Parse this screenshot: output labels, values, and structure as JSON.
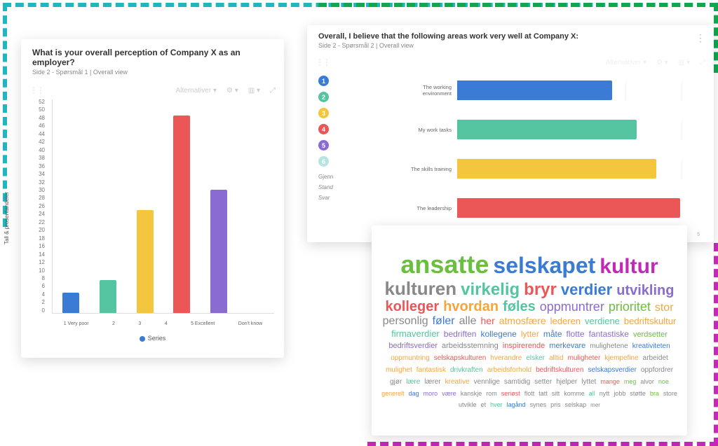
{
  "chart_data": [
    {
      "id": "bar",
      "type": "bar",
      "title": "What is your overall perception of Company X as an employer?",
      "subtitle": "Side 2 - Spørsmål 1 | Overall view",
      "ylabel": "Tall & prosentandeler",
      "ylim": [
        0,
        52
      ],
      "yticks": [
        52,
        50,
        48,
        46,
        44,
        42,
        40,
        38,
        36,
        34,
        32,
        30,
        28,
        26,
        24,
        22,
        20,
        18,
        16,
        14,
        12,
        10,
        8,
        6,
        4,
        2,
        0
      ],
      "categories": [
        "1 Very poor",
        "2",
        "3",
        "4",
        "5 Excellent",
        "Don't know"
      ],
      "values": [
        5,
        8,
        25,
        48,
        30,
        0
      ],
      "colors": [
        "#3a7bd5",
        "#55c5a1",
        "#f4c63d",
        "#eb5757",
        "#8a6bd1",
        "#c7c7c7"
      ],
      "legend_label": "Series",
      "toolbar": {
        "alt_label": "Alternativer"
      }
    },
    {
      "id": "hbar",
      "type": "bar",
      "orientation": "horizontal",
      "title": "Overall, I believe that the following areas work very well at Company X:",
      "subtitle": "Side 2 - Spørsmål 2 | Overall view",
      "xlim": [
        0,
        5
      ],
      "categories": [
        "The working environment",
        "My work tasks",
        "The skills training",
        "The leadership"
      ],
      "values": [
        3.2,
        3.7,
        4.1,
        4.6
      ],
      "colors": [
        "#3a7bd5",
        "#55c5a1",
        "#f4c63d",
        "#eb5757"
      ],
      "legend_badges": [
        {
          "n": "1",
          "c": "#3a7bd5"
        },
        {
          "n": "2",
          "c": "#55c5a1"
        },
        {
          "n": "3",
          "c": "#f4c63d"
        },
        {
          "n": "4",
          "c": "#eb5757"
        },
        {
          "n": "5",
          "c": "#8a6bd1"
        },
        {
          "n": "6",
          "c": "#b7e3e0"
        }
      ],
      "side_stats": [
        "Gjenn",
        "Stand",
        "Svar"
      ]
    }
  ],
  "wordcloud": {
    "words": [
      {
        "t": "ansatte",
        "s": 36,
        "c": "#6bbf3f"
      },
      {
        "t": "selskapet",
        "s": 32,
        "c": "#3a7bd5"
      },
      {
        "t": "kultur",
        "s": 30,
        "c": "#c229b8"
      },
      {
        "t": "kulturen",
        "s": 26,
        "c": "#888"
      },
      {
        "t": "virkelig",
        "s": 24,
        "c": "#55c5a1"
      },
      {
        "t": "bryr",
        "s": 24,
        "c": "#eb5757"
      },
      {
        "t": "verdier",
        "s": 22,
        "c": "#3a7bd5"
      },
      {
        "t": "utvikling",
        "s": 20,
        "c": "#8a6bd1"
      },
      {
        "t": "kolleger",
        "s": 20,
        "c": "#eb5757"
      },
      {
        "t": "hvordan",
        "s": 20,
        "c": "#f4a63d"
      },
      {
        "t": "føles",
        "s": 20,
        "c": "#55c5a1"
      },
      {
        "t": "oppmuntrer",
        "s": 18,
        "c": "#8a6bd1"
      },
      {
        "t": "prioritet",
        "s": 18,
        "c": "#6bbf3f"
      },
      {
        "t": "stor",
        "s": 16,
        "c": "#f4a63d"
      },
      {
        "t": "personlig",
        "s": 16,
        "c": "#888"
      },
      {
        "t": "føler",
        "s": 16,
        "c": "#3a7bd5"
      },
      {
        "t": "alle",
        "s": 16,
        "c": "#888"
      },
      {
        "t": "her",
        "s": 14,
        "c": "#eb5757"
      },
      {
        "t": "atmosfære",
        "s": 14,
        "c": "#f4a63d"
      },
      {
        "t": "lederen",
        "s": 13,
        "c": "#f4a63d"
      },
      {
        "t": "verdiene",
        "s": 13,
        "c": "#55c5a1"
      },
      {
        "t": "bedriftskultur",
        "s": 13,
        "c": "#f4a63d"
      },
      {
        "t": "firmaverdier",
        "s": 13,
        "c": "#55c5a1"
      },
      {
        "t": "bedriften",
        "s": 12,
        "c": "#8a6bd1"
      },
      {
        "t": "kollegene",
        "s": 12,
        "c": "#3a7bd5"
      },
      {
        "t": "lytter",
        "s": 12,
        "c": "#f4a63d"
      },
      {
        "t": "måte",
        "s": 12,
        "c": "#3a7bd5"
      },
      {
        "t": "flotte",
        "s": 12,
        "c": "#8a6bd1"
      },
      {
        "t": "fantastiske",
        "s": 12,
        "c": "#8a6bd1"
      },
      {
        "t": "verdsetter",
        "s": 11,
        "c": "#6bbf3f"
      },
      {
        "t": "bedriftsverdier",
        "s": 11,
        "c": "#8a6bd1"
      },
      {
        "t": "arbeidsstemning",
        "s": 11,
        "c": "#888"
      },
      {
        "t": "inspirerende",
        "s": 11,
        "c": "#eb5757"
      },
      {
        "t": "merkevare",
        "s": 11,
        "c": "#3a7bd5"
      },
      {
        "t": "mulighetene",
        "s": 10,
        "c": "#888"
      },
      {
        "t": "kreativiteten",
        "s": 10,
        "c": "#3a7bd5"
      },
      {
        "t": "oppmuntring",
        "s": 10,
        "c": "#f4a63d"
      },
      {
        "t": "selskapskulturen",
        "s": 10,
        "c": "#eb5757"
      },
      {
        "t": "hverandre",
        "s": 10,
        "c": "#f4a63d"
      },
      {
        "t": "elsker",
        "s": 10,
        "c": "#55c5a1"
      },
      {
        "t": "alltid",
        "s": 10,
        "c": "#f4a63d"
      },
      {
        "t": "muligheter",
        "s": 10,
        "c": "#eb5757"
      },
      {
        "t": "kjempefine",
        "s": 10,
        "c": "#f4a63d"
      },
      {
        "t": "arbeidet",
        "s": 10,
        "c": "#888"
      },
      {
        "t": "mulighet",
        "s": 10,
        "c": "#f4a63d"
      },
      {
        "t": "fantastisk",
        "s": 10,
        "c": "#f4a63d"
      },
      {
        "t": "drivkraften",
        "s": 10,
        "c": "#55c5a1"
      },
      {
        "t": "arbeidsforhold",
        "s": 10,
        "c": "#f4a63d"
      },
      {
        "t": "bedriftskulturen",
        "s": 10,
        "c": "#eb5757"
      },
      {
        "t": "selskapsverdier",
        "s": 10,
        "c": "#3a7bd5"
      },
      {
        "t": "oppfordrer",
        "s": 10,
        "c": "#888"
      },
      {
        "t": "gjør",
        "s": 10,
        "c": "#888"
      },
      {
        "t": "lære",
        "s": 10,
        "c": "#55c5a1"
      },
      {
        "t": "lærer",
        "s": 10,
        "c": "#888"
      },
      {
        "t": "kreative",
        "s": 10,
        "c": "#f4a63d"
      },
      {
        "t": "vennlige",
        "s": 10,
        "c": "#888"
      },
      {
        "t": "samtidig",
        "s": 10,
        "c": "#888"
      },
      {
        "t": "setter",
        "s": 10,
        "c": "#888"
      },
      {
        "t": "hjelper",
        "s": 10,
        "c": "#888"
      },
      {
        "t": "lyttet",
        "s": 10,
        "c": "#888"
      },
      {
        "t": "mange",
        "s": 9,
        "c": "#eb5757"
      },
      {
        "t": "meg",
        "s": 9,
        "c": "#6bbf3f"
      },
      {
        "t": "alvor",
        "s": 9,
        "c": "#888"
      },
      {
        "t": "noe",
        "s": 9,
        "c": "#6bbf3f"
      },
      {
        "t": "generelt",
        "s": 9,
        "c": "#f4a63d"
      },
      {
        "t": "dag",
        "s": 9,
        "c": "#3a7bd5"
      },
      {
        "t": "moro",
        "s": 9,
        "c": "#8a6bd1"
      },
      {
        "t": "være",
        "s": 9,
        "c": "#8a6bd1"
      },
      {
        "t": "kanskje",
        "s": 9,
        "c": "#888"
      },
      {
        "t": "rom",
        "s": 9,
        "c": "#888"
      },
      {
        "t": "seriøst",
        "s": 9,
        "c": "#eb5757"
      },
      {
        "t": "flott",
        "s": 9,
        "c": "#888"
      },
      {
        "t": "tatt",
        "s": 9,
        "c": "#888"
      },
      {
        "t": "sitt",
        "s": 9,
        "c": "#888"
      },
      {
        "t": "komme",
        "s": 9,
        "c": "#888"
      },
      {
        "t": "all",
        "s": 9,
        "c": "#55c5a1"
      },
      {
        "t": "nytt",
        "s": 9,
        "c": "#888"
      },
      {
        "t": "jobb",
        "s": 9,
        "c": "#888"
      },
      {
        "t": "støtte",
        "s": 9,
        "c": "#888"
      },
      {
        "t": "bra",
        "s": 9,
        "c": "#6bbf3f"
      },
      {
        "t": "store",
        "s": 9,
        "c": "#888"
      },
      {
        "t": "utvikle",
        "s": 9,
        "c": "#888"
      },
      {
        "t": "et",
        "s": 9,
        "c": "#888"
      },
      {
        "t": "hver",
        "s": 9,
        "c": "#55c5a1"
      },
      {
        "t": "lagånd",
        "s": 9,
        "c": "#3a7bd5"
      },
      {
        "t": "synes",
        "s": 9,
        "c": "#888"
      },
      {
        "t": "pris",
        "s": 9,
        "c": "#888"
      },
      {
        "t": "selskap",
        "s": 9,
        "c": "#888"
      },
      {
        "t": "mer",
        "s": 8,
        "c": "#888"
      }
    ]
  }
}
